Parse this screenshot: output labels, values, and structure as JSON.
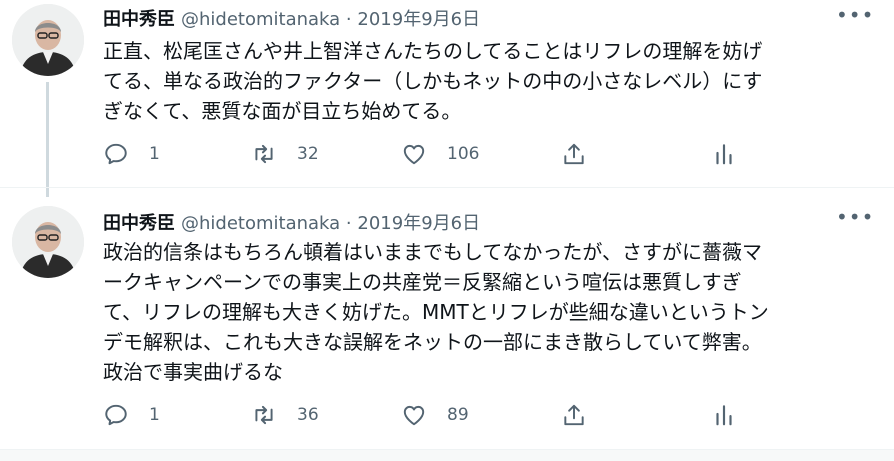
{
  "tweets": [
    {
      "author_name": "田中秀臣",
      "handle": "@hidetomitanaka",
      "separator": "·",
      "date": "2019年9月6日",
      "more": "•••",
      "lines": [
        "正直、松尾匡さんや井上智洋さんたちのしてることはリフレの理解を妨げ",
        "てる、単なる政治的ファクター（しかもネットの中の小さなレベル）にす",
        "ぎなくて、悪質な面が目立ち始めてる。"
      ],
      "replies": "1",
      "retweets": "32",
      "likes": "106"
    },
    {
      "author_name": "田中秀臣",
      "handle": "@hidetomitanaka",
      "separator": "·",
      "date": "2019年9月6日",
      "more": "•••",
      "lines": [
        "政治的信条はもちろん頓着はいままでもしてなかったが、さすがに薔薇マ",
        "ークキャンペーンでの事実上の共産党＝反緊縮という喧伝は悪質しすぎ",
        "て、リフレの理解も大きく妨げた。MMTとリフレが些細な違いというトン",
        "デモ解釈は、これも大きな誤解をネットの一部にまき散らしていて弊害。",
        "政治で事実曲げるな"
      ],
      "replies": "1",
      "retweets": "36",
      "likes": "89"
    }
  ],
  "icons": {
    "reply": "reply-icon",
    "retweet": "retweet-icon",
    "like": "heart-icon",
    "share": "share-icon",
    "stats": "analytics-icon"
  },
  "colors": {
    "text": "#0f1419",
    "secondary": "#536471",
    "thread_line": "#cfd9de"
  }
}
